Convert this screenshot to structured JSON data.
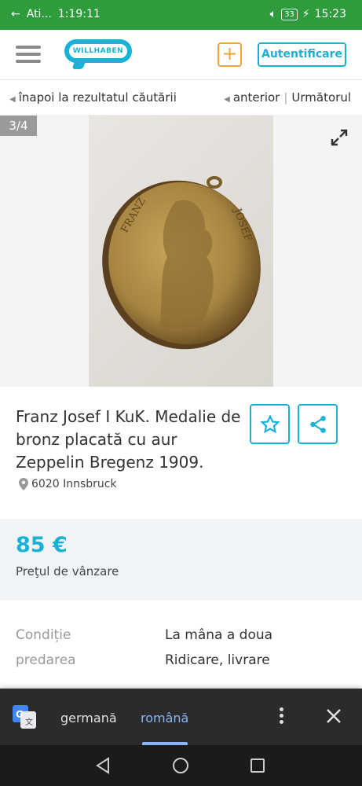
{
  "status_bar": {
    "app": "Ati...",
    "time_left": "1:19:11",
    "battery": "33",
    "time_right": "15:23"
  },
  "header": {
    "logo_text": "WILLHABEN",
    "plus_label": "+",
    "auth_label": "Autentificare"
  },
  "nav": {
    "back_label": "înapoi la rezultatul căutării",
    "prev_label": "anterior",
    "separator": "|",
    "next_label": "Următorul"
  },
  "gallery": {
    "counter": "3/4",
    "coin_text_left": "FRANZ",
    "coin_text_right": "JOSEF"
  },
  "listing": {
    "title": "Franz Josef I KuK. Medalie de bronz placată cu aur Zeppelin Bregenz 1909.",
    "location": "6020 Innsbruck",
    "price": "85 €",
    "price_label": "Preţul de vânzare",
    "attributes": [
      {
        "key": "Condiție",
        "value": "La mâna a doua"
      },
      {
        "key": "predarea",
        "value": "Ridicare, livrare"
      }
    ]
  },
  "translate": {
    "source_lang": "germană",
    "target_lang": "română"
  },
  "colors": {
    "accent": "#17b2d6",
    "status_bar": "#2e9b3c",
    "plus": "#f0a43a"
  }
}
